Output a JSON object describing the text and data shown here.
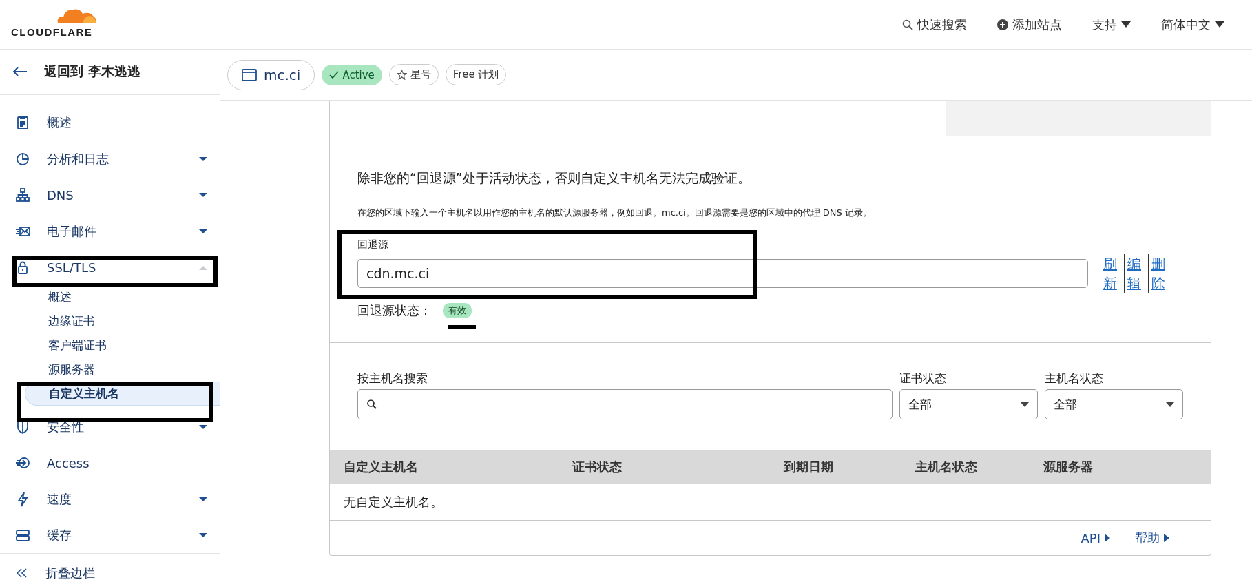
{
  "brand": {
    "name": "CLOUDFLARE"
  },
  "top_nav": [
    {
      "kind": "search",
      "label": "快速搜索"
    },
    {
      "kind": "add",
      "label": "添加站点"
    },
    {
      "kind": "menu",
      "label": "支持"
    },
    {
      "kind": "menu",
      "label": "简体中文"
    }
  ],
  "back": {
    "label": "返回到 李木逃逃"
  },
  "zone": {
    "name": "mc.ci",
    "status": "Active",
    "star": "星号",
    "plan": "Free 计划"
  },
  "sidebar": {
    "items": [
      {
        "kind": "doc",
        "label": "概述",
        "has_menu": false
      },
      {
        "kind": "chart",
        "label": "分析和日志",
        "has_menu": true,
        "expanded": false
      },
      {
        "kind": "tree",
        "label": "DNS",
        "has_menu": true,
        "expanded": false
      },
      {
        "kind": "mail",
        "label": "电子邮件",
        "has_menu": true,
        "expanded": false
      },
      {
        "kind": "lock",
        "label": "SSL/TLS",
        "has_menu": true,
        "expanded": true,
        "children": [
          {
            "label": "概述",
            "selected": false
          },
          {
            "label": "边缘证书",
            "selected": false
          },
          {
            "label": "客户端证书",
            "selected": false
          },
          {
            "label": "源服务器",
            "selected": false
          },
          {
            "label": "自定义主机名",
            "selected": true
          }
        ]
      },
      {
        "kind": "shield",
        "label": "安全性",
        "has_menu": true,
        "expanded": false
      },
      {
        "kind": "access",
        "label": "Access",
        "has_menu": false
      },
      {
        "kind": "bolt",
        "label": "速度",
        "has_menu": true,
        "expanded": false
      },
      {
        "kind": "drive",
        "label": "缓存",
        "has_menu": true,
        "expanded": false
      }
    ],
    "collapse": "折叠边栏"
  },
  "fallback": {
    "heading": "除非您的“回退源”处于活动状态，否则自定义主机名无法完成验证。",
    "description": "在您的区域下输入一个主机名以用作您的主机名的默认源服务器，例如回退。mc.ci。回退源需要是您的区域中的代理 DNS 记录。",
    "field_label": "回退源",
    "value": "cdn.mc.ci",
    "actions": [
      "刷新",
      "编辑",
      "删除"
    ],
    "status_label": "回退源状态：",
    "status": "有效"
  },
  "filters": {
    "search_label": "按主机名搜索",
    "selects": [
      {
        "label": "证书状态",
        "value": "全部"
      },
      {
        "label": "主机名状态",
        "value": "全部"
      }
    ]
  },
  "table": {
    "columns": [
      "自定义主机名",
      "证书状态",
      "到期日期",
      "主机名状态",
      "源服务器"
    ],
    "empty": "无自定义主机名。"
  },
  "footer_links": [
    "API",
    "帮助"
  ]
}
